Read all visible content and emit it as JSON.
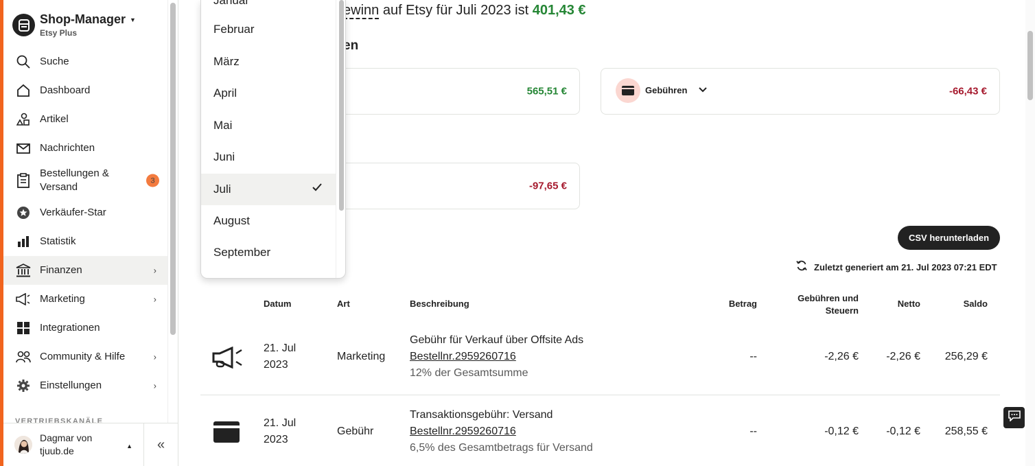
{
  "sidebar": {
    "brand_title": "Shop-Manager",
    "brand_subtitle": "Etsy Plus",
    "items": [
      {
        "label": "Suche"
      },
      {
        "label": "Dashboard"
      },
      {
        "label": "Artikel"
      },
      {
        "label": "Nachrichten"
      },
      {
        "label": "Bestellungen & Versand",
        "badge": "3"
      },
      {
        "label": "Verkäufer-Star"
      },
      {
        "label": "Statistik"
      },
      {
        "label": "Finanzen"
      },
      {
        "label": "Marketing"
      },
      {
        "label": "Integrationen"
      },
      {
        "label": "Community & Hilfe"
      },
      {
        "label": "Einstellungen"
      }
    ],
    "section_label": "VERTRIEBSKANÄLE",
    "user_name": "Dagmar von tjuub.de",
    "accent_color": "#f1641e"
  },
  "header": {
    "headline_part1": "ewinn",
    "headline_part2": " auf Etsy für Juli 2023 ist ",
    "headline_amount": "401,43 €",
    "subhead": "en"
  },
  "cards": {
    "sales_amount": "565,51 €",
    "fees_label": "Gebühren",
    "fees_amount": "-66,43 €",
    "other_amount": "-97,65 €"
  },
  "actions": {
    "csv_button": "CSV herunterladen",
    "generated_text": "Zuletzt generiert am 21. Jul 2023 07:21 EDT"
  },
  "table": {
    "headers": [
      "Datum",
      "Art",
      "Beschreibung",
      "Betrag",
      "Gebühren und Steuern",
      "Netto",
      "Saldo"
    ],
    "rows": [
      {
        "icon": "megaphone-icon",
        "date_day": "21. Jul",
        "date_year": "2023",
        "type": "Marketing",
        "desc_title": "Gebühr für Verkauf über Offsite Ads",
        "desc_link": "Bestellnr.2959260716",
        "desc_note": "12% der Gesamtsumme",
        "amount": "--",
        "fees": "-2,26 €",
        "net": "-2,26 €",
        "balance": "256,29 €"
      },
      {
        "icon": "credit-card-icon",
        "date_day": "21. Jul",
        "date_year": "2023",
        "type": "Gebühr",
        "desc_title": "Transaktionsgebühr: Versand",
        "desc_link": "Bestellnr.2959260716",
        "desc_note": "6,5% des Gesamtbetrags für Versand",
        "amount": "--",
        "fees": "-0,12 €",
        "net": "-0,12 €",
        "balance": "258,55 €"
      }
    ]
  },
  "month_dropdown": {
    "items": [
      "Januar",
      "Februar",
      "März",
      "April",
      "Mai",
      "Juni",
      "Juli",
      "August",
      "September"
    ],
    "selected": "Juli"
  }
}
